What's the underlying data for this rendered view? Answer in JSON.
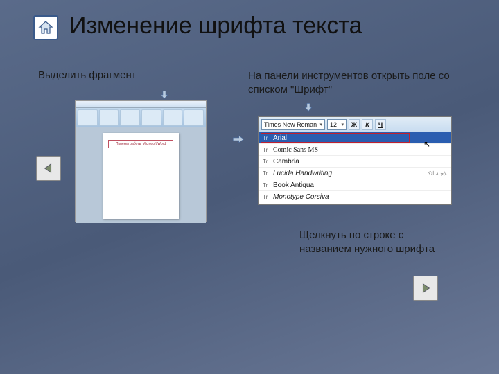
{
  "title": "Изменение шрифта текста",
  "steps": {
    "s1": "Выделить фрагмент",
    "s2": "На панели инструментов открыть поле со списком \"Шрифт\"",
    "s3": "Щелкнуть по строке с названием нужного шрифта"
  },
  "word_highlight_text": "Приемы работы Microsoft Word",
  "toolbar": {
    "font_name": "Times New Roman",
    "font_size": "12",
    "bold": "Ж",
    "italic": "К",
    "underline": "Ч"
  },
  "fonts": [
    {
      "name": "Arial",
      "hl": true,
      "boxed": true
    },
    {
      "name": "Comic Sans MS",
      "hl": false,
      "boxed": false
    },
    {
      "name": "Cambria",
      "hl": false,
      "boxed": false
    },
    {
      "name": "Lucida Handwriting",
      "hl": false,
      "boxed": false,
      "preview": "ﻼﺟ ﺔﺑﺎﺘﻛ"
    },
    {
      "name": "Book Antiqua",
      "hl": false,
      "boxed": false
    },
    {
      "name": "Monotype Corsiva",
      "hl": false,
      "boxed": false
    }
  ]
}
